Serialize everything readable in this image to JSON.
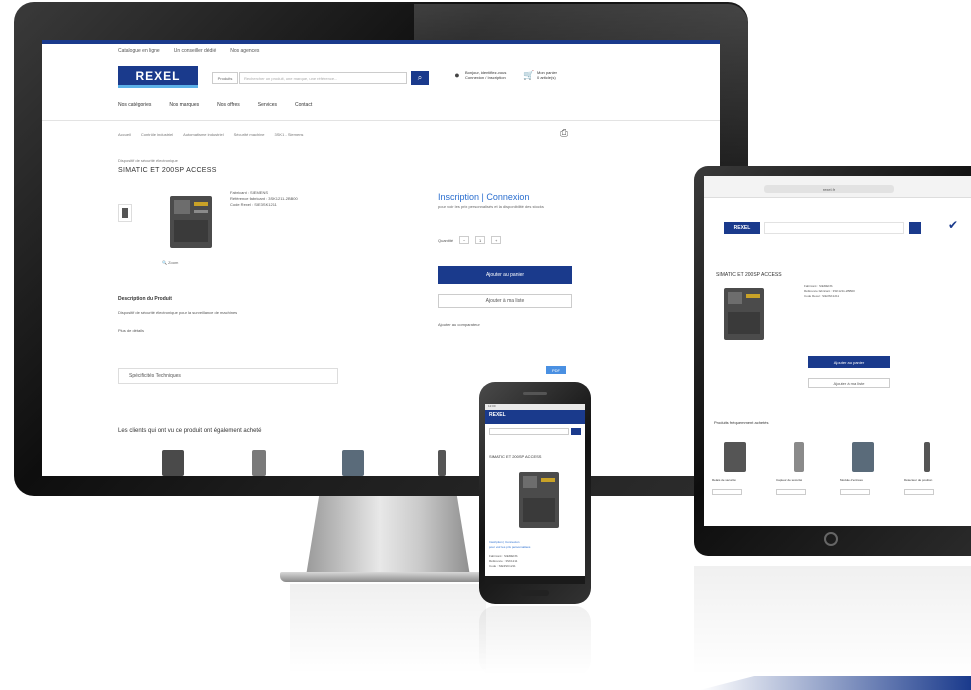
{
  "desktop": {
    "utility_links": [
      "Catalogue en ligne",
      "Un conseiller dédié",
      "Nos agences"
    ],
    "logo_text": "REXEL",
    "search": {
      "scope_label": "Produits",
      "placeholder": "Rechercher un produit, une marque, une référence..."
    },
    "account": {
      "line1": "Bonjour, identifiez-vous",
      "line2": "Connexion / Inscription"
    },
    "cart": {
      "line1": "Mon panier",
      "line2": "0 article(s)"
    },
    "nav": [
      "Nos catégories",
      "Nos marques",
      "Nos offres",
      "Services",
      "Contact"
    ],
    "breadcrumb": [
      "Accueil",
      "Contrôle industriel",
      "Automatisme industriel",
      "Sécurité machine",
      "3SK1 - Siemens"
    ],
    "overline": "Dispositif de sécurité électronique",
    "product_title": "SIMATIC ET 200SP ACCESS",
    "specs": [
      "Fabricant : SIEMENS",
      "Référence fabricant : 3SK1211-2BB00",
      "Code Rexel : SIE3SK1211"
    ],
    "zoom_label": "Zoom",
    "login": {
      "link": "Inscription | Connexion",
      "note": "pour voir les prix personnalisés et la disponibilité des stocks"
    },
    "quantity": {
      "label": "Quantité",
      "value": "1"
    },
    "add_to_cart": "Ajouter au panier",
    "add_to_list": "Ajouter à ma liste",
    "compare": "Ajouter au comparateur",
    "description_title": "Description du Produit",
    "description_text": "Dispositif de sécurité électronique pour la surveillance de machines",
    "description_more": "Plus de détails",
    "spec_tab": "Spécificités Techniques",
    "badge": "PDF",
    "related_title": "Les clients qui ont vu ce produit ont également acheté"
  },
  "phone": {
    "status": "12:00",
    "logo_text": "REXEL",
    "title": "SIMATIC ET 200SP ACCESS",
    "link_lines": [
      "Inscription | Connexion",
      "pour voir les prix personnalisés"
    ],
    "table_rows": [
      "Fabricant : SIEMENS",
      "Référence : 3SK1211",
      "Code : SIE3SK1211"
    ]
  },
  "tablet": {
    "url": "rexel.fr",
    "logo_text": "REXEL",
    "title": "SIMATIC ET 200SP ACCESS",
    "specs": [
      "Fabricant : SIEMENS",
      "Référence fabricant : 3SK1211-2BB00",
      "Code Rexel : SIE3SK1211"
    ],
    "add_to_cart": "Ajouter au panier",
    "add_to_list": "Ajouter à ma liste",
    "related_title": "Produits fréquemment achetés",
    "cards": [
      "Relais de sécurité",
      "Capteur de sécurité",
      "Module d'entrées",
      "Détecteur de position"
    ]
  }
}
